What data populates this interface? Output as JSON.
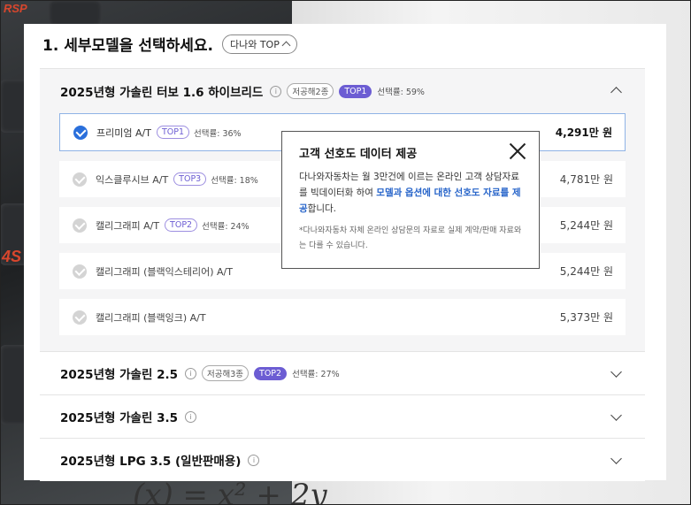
{
  "section_heading": "1. 세부모델을 선택하세요.",
  "sort_pill": "다나와 TOP",
  "expanded_section": {
    "title": "2025년형 가솔린 터보 1.6 하이브리드",
    "info": "i",
    "tag": "저공해2종",
    "top_badge": "TOP1",
    "rate": "선택률: 59%"
  },
  "options": [
    {
      "name": "프리미엄 A/T",
      "top": "TOP1",
      "rate": "선택률: 36%",
      "price": "4,291만 원",
      "selected": true
    },
    {
      "name": "익스클루시브 A/T",
      "top": "TOP3",
      "rate": "선택률: 18%",
      "price": "4,781만 원",
      "selected": false
    },
    {
      "name": "캘리그래피 A/T",
      "top": "TOP2",
      "rate": "선택률: 24%",
      "price": "5,244만 원",
      "selected": false
    },
    {
      "name": "캘리그래피 (블랙익스테리어) A/T",
      "top": "",
      "rate": "",
      "price": "5,244만 원",
      "selected": false
    },
    {
      "name": "캘리그래피 (블랙잉크) A/T",
      "top": "",
      "rate": "",
      "price": "5,373만 원",
      "selected": false
    }
  ],
  "collapsed_sections": [
    {
      "title": "2025년형 가솔린 2.5",
      "tag": "저공해3종",
      "top_badge": "TOP2",
      "rate": "선택률: 27%"
    },
    {
      "title": "2025년형 가솔린 3.5",
      "tag": "",
      "top_badge": "",
      "rate": ""
    },
    {
      "title": "2025년형 LPG 3.5 (일반판매용)",
      "tag": "",
      "top_badge": "",
      "rate": ""
    }
  ],
  "tooltip": {
    "title": "고객 선호도 데이터 제공",
    "body_pre": "다나와자동차는 월 3만건에 이르는 온라인 고객 상담자료를 빅데이터화 하여 ",
    "body_highlight": "모델과 옵션에 대한 선호도 자료를 제공",
    "body_post": "합니다.",
    "note": "*다나와자동차 자체 온라인 상담문의 자료로 실제 계약/판매 자료와는 다를 수 있습니다."
  },
  "background_math": "(x) = x² + 2y",
  "colors": {
    "accent": "#2a6fdb",
    "top_badge": "#6c5dd3",
    "highlight": "#2563c9"
  }
}
